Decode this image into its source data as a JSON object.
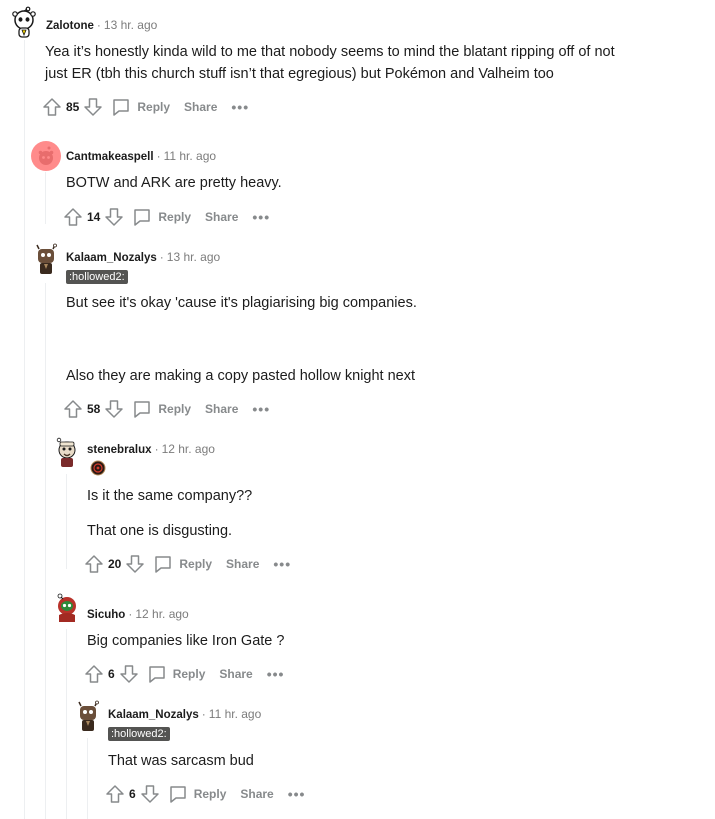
{
  "comments": [
    {
      "user": "Zalotone",
      "time": "13 hr. ago",
      "lines": [
        "Yea it’s honestly kinda wild to me that nobody seems to mind the blatant ripping off of not",
        "just ER (tbh this church stuff isn’t that egregious) but Pokémon and Valheim too"
      ],
      "score": "85",
      "reply": "Reply",
      "share": "Share",
      "more": "•••"
    },
    {
      "user": "Cantmakeaspell",
      "time": "11 hr. ago",
      "lines": [
        "BOTW and ARK are pretty heavy."
      ],
      "score": "14",
      "reply": "Reply",
      "share": "Share",
      "more": "•••"
    },
    {
      "user": "Kalaam_Nozalys",
      "time": "13 hr. ago",
      "flair": ":hollowed2:",
      "lines": [
        "But see it's okay 'cause it's plagiarising big companies.",
        "Also they are making a copy pasted hollow knight next"
      ],
      "score": "58",
      "reply": "Reply",
      "share": "Share",
      "more": "•••"
    },
    {
      "user": "stenebralux",
      "time": "12 hr. ago",
      "lines": [
        "Is it the same company??",
        "That one is disgusting."
      ],
      "score": "20",
      "reply": "Reply",
      "share": "Share",
      "more": "•••"
    },
    {
      "user": "Sicuho",
      "time": "12 hr. ago",
      "lines": [
        "Big companies like Iron Gate ?"
      ],
      "score": "6",
      "reply": "Reply",
      "share": "Share",
      "more": "•••"
    },
    {
      "user": "Kalaam_Nozalys",
      "time": "11 hr. ago",
      "flair": ":hollowed2:",
      "lines": [
        "That was sarcasm bud"
      ],
      "score": "6",
      "reply": "Reply",
      "share": "Share",
      "more": "•••"
    }
  ],
  "separator": "·",
  "icons": {
    "upvote": "arrow-up-icon",
    "downvote": "arrow-down-icon",
    "reply": "speech-bubble-icon",
    "more": "ellipsis-icon"
  },
  "colors": {
    "text": "#1c1c1c",
    "meta": "#7c7c7c",
    "action": "#878a8c",
    "flair_bg": "#545452",
    "thread_line": "#edeff1",
    "default_avatar": "#ff8b8b"
  }
}
